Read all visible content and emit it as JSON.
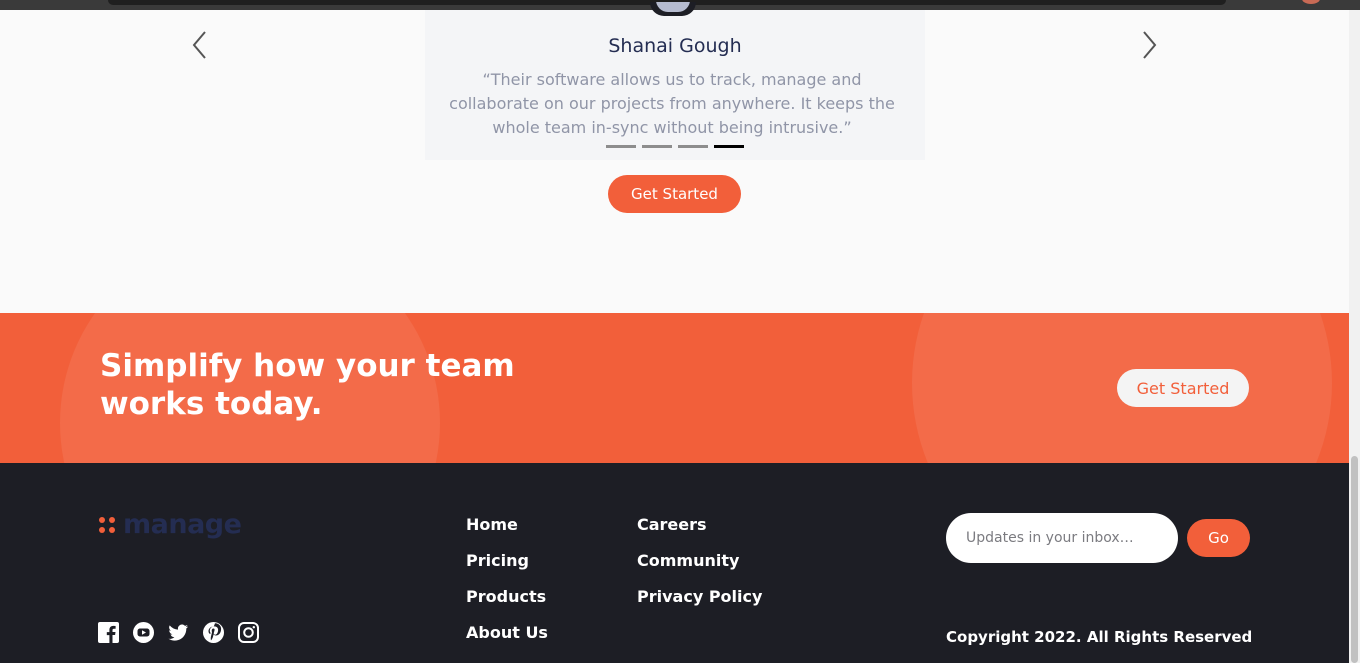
{
  "testimonial": {
    "name": "Shanai Gough",
    "quote": "“Their software allows us to track, manage and collaborate on our projects from anywhere. It keeps the whole team in-sync without being intrusive.”",
    "active_slide": 4,
    "slide_count": 4
  },
  "main_cta_label": "Get Started",
  "band": {
    "title": "Simplify how your team works today.",
    "cta_label": "Get Started"
  },
  "footer": {
    "logo_text": "manage",
    "links_col1": [
      "Home",
      "Pricing",
      "Products",
      "About Us"
    ],
    "links_col2": [
      "Careers",
      "Community",
      "Privacy Policy"
    ],
    "social_icons": [
      "facebook-icon",
      "youtube-icon",
      "twitter-icon",
      "pinterest-icon",
      "instagram-icon"
    ],
    "newsletter_placeholder": "Updates in your inbox…",
    "go_label": "Go",
    "copyright": "Copyright 2022. All Rights Reserved"
  },
  "colors": {
    "accent": "#f25f3a",
    "dark": "#1d1e25",
    "navy": "#242d52"
  }
}
